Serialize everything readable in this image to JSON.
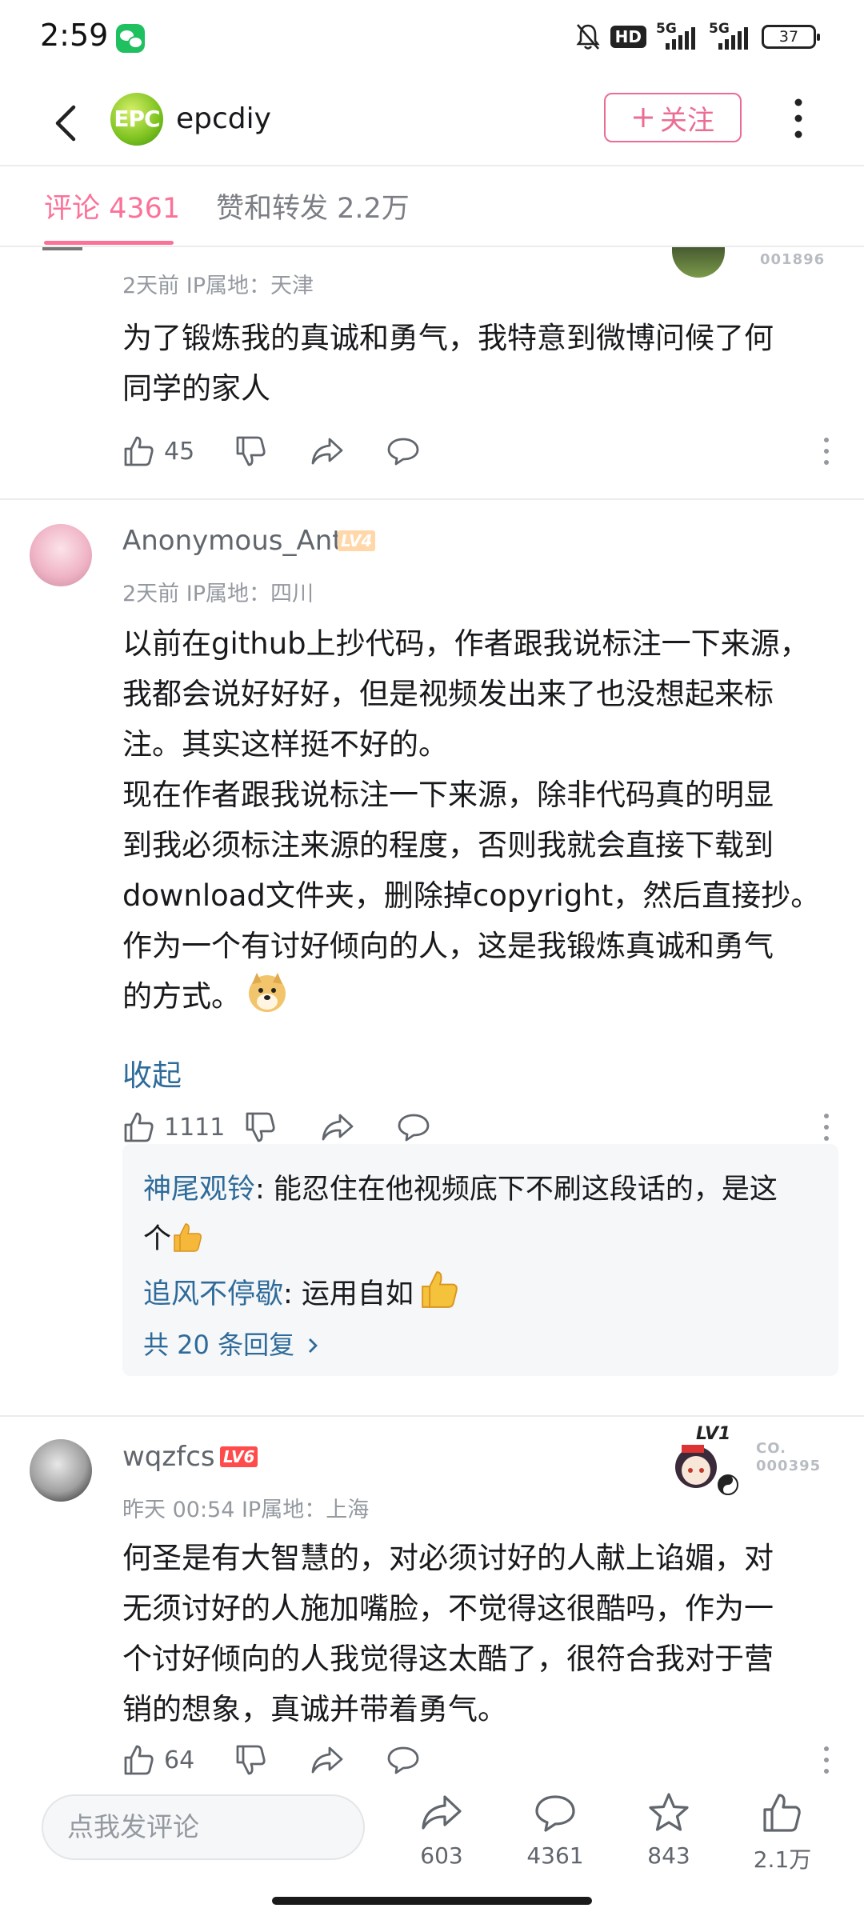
{
  "status_bar": {
    "time": "2:59",
    "hd_label": "HD",
    "signal1_label": "5G",
    "signal2_label": "5G",
    "battery": "37"
  },
  "header": {
    "profile_logo_text": "EPC",
    "profile_name": "epcdiy",
    "follow_label": "关注"
  },
  "tabs": {
    "comments": "评论 4361",
    "likes_shares": "赞和转发 2.2万"
  },
  "comments": [
    {
      "meta": "2天前 IP属地：天津",
      "text": "为了锻炼我的真诚和勇气，我特意到微博问候了何\n同学的家人",
      "likes": "45",
      "decoration_text": "001896"
    },
    {
      "name": "Anonymous_Ant",
      "level": "LV4",
      "meta": "2天前 IP属地：四川",
      "text": "以前在github上抄代码，作者跟我说标注一下来源，\n我都会说好好好，但是视频发出来了也没想起来标\n注。其实这样挺不好的。\n现在作者跟我说标注一下来源，除非代码真的明显\n到我必须标注来源的程度，否则我就会直接下载到\ndownload文件夹，删除掉copyright，然后直接抄。\n作为一个有讨好倾向的人，这是我锻炼真诚和勇气\n的方式。",
      "collapse_label": "收起",
      "likes": "1111",
      "replies": [
        {
          "user": "神尾观铃",
          "text": ": 能忍住在他视频底下不刷这段话的，是这",
          "text2": "个"
        },
        {
          "user": "追风不停歇",
          "text": ": 运用自如"
        }
      ],
      "reply_total": "共 20 条回复"
    },
    {
      "name": "wqzfcs",
      "level": "LV6",
      "meta": "昨天 00:54 IP属地：上海",
      "text": "何圣是有大智慧的，对必须讨好的人献上谄媚，对\n无须讨好的人施加嘴脸，不觉得这很酷吗，作为一\n个讨好倾向的人我觉得这太酷了，很符合我对于营\n销的想象，真诚并带着勇气。",
      "likes": "64",
      "decoration_level": "LV1",
      "decoration_label": "CO.",
      "decoration_number": "000395"
    }
  ],
  "bottom_bar": {
    "input_placeholder": "点我发评论",
    "shares": "603",
    "comments": "4361",
    "favorites": "843",
    "likes": "2.1万"
  }
}
